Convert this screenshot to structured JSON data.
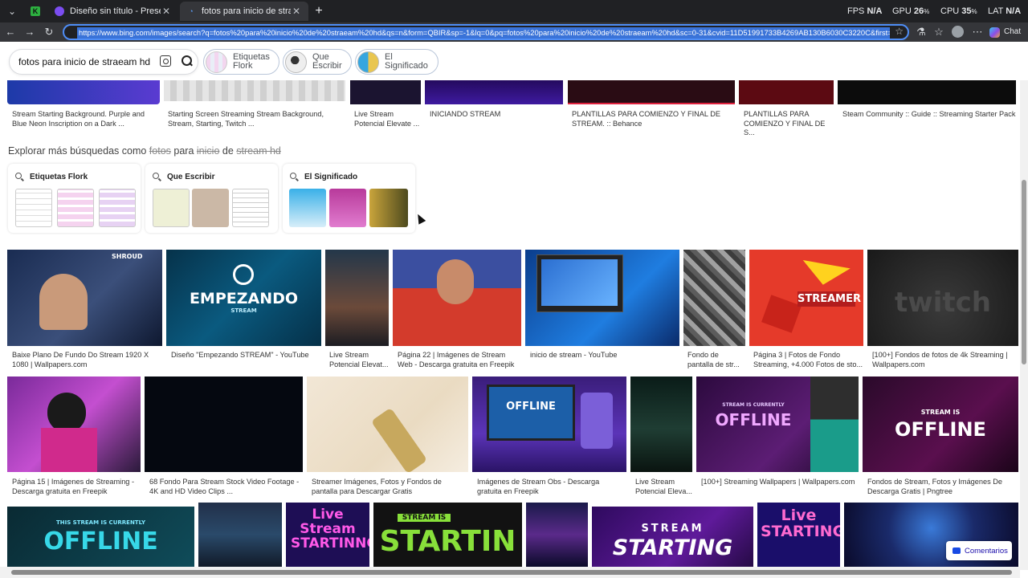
{
  "browser": {
    "tabs": [
      {
        "title": "",
        "favicon": "kahoot-icon",
        "active": false
      },
      {
        "title": "Diseño sin título - Presentación",
        "favicon": "canva-icon",
        "active": false
      },
      {
        "title": "fotos para inicio de straeam hd - B",
        "favicon": "bing-icon",
        "active": true
      }
    ],
    "new_tab": "+",
    "perf": {
      "fps_label": "FPS",
      "fps_value": "N/A",
      "gpu_label": "GPU",
      "gpu_value": "26",
      "cpu_label": "CPU",
      "cpu_value": "35",
      "lat_label": "LAT",
      "lat_value": "N/A",
      "percent": "%"
    },
    "url": "https://www.bing.com/images/search?q=fotos%20para%20inicio%20de%20straeam%20hd&qs=n&form=QBIR&sp=-1&lq=0&pq=fotos%20para%20inicio%20de%20straeam%20hd&sc=0-31&cvid=11D51991733B4269AB130B6030C3220C&first=",
    "chat_label": "Chat"
  },
  "search": {
    "query": "fotos para inicio de straeam hd",
    "chips": [
      {
        "label": "Etiquetas\nFlork"
      },
      {
        "label": "Que\nEscribir"
      },
      {
        "label": "El\nSignificado"
      }
    ]
  },
  "top_row": [
    {
      "caption": "Stream Starting Background. Purple and Blue Neon Inscription on a Dark ..."
    },
    {
      "caption": "Starting Screen Streaming Stream Background, Stream, Starting, Twitch ..."
    },
    {
      "caption": "Live Stream Potencial Elevate ..."
    },
    {
      "caption": "INICIANDO STREAM"
    },
    {
      "caption": "PLANTILLAS PARA COMIENZO Y FINAL DE STREAM. :: Behance"
    },
    {
      "caption": "PLANTILLAS PARA COMIENZO Y FINAL DE S..."
    },
    {
      "caption": "Steam Community :: Guide :: Streaming Starter Pack"
    }
  ],
  "explore": {
    "heading_prefix": "Explorar más búsquedas como",
    "word1": "fotos",
    "word2": "para",
    "word3": "inicio",
    "word4": "de",
    "word5": "stream hd",
    "cards": [
      {
        "label": "Etiquetas Flork"
      },
      {
        "label": "Que Escribir"
      },
      {
        "label": "El Significado"
      }
    ]
  },
  "row1": [
    {
      "caption": "Baixe Plano De Fundo Do Stream 1920 X 1080 | Wallpapers.com",
      "overlay": "SHROUD"
    },
    {
      "caption": "Diseño \"Empezando STREAM\" - YouTube",
      "overlay": "EMPEZANDO",
      "overlay2": "STREAM"
    },
    {
      "caption": "Live Stream Potencial Elevat..."
    },
    {
      "caption": "Página 22 | Imágenes de Stream Web - Descarga gratuita en Freepik"
    },
    {
      "caption": "inicio de stream - YouTube"
    },
    {
      "caption": "Fondo de pantalla de str..."
    },
    {
      "caption": "Página 3 | Fotos de Fondo Streaming, +4.000 Fotos de sto...",
      "overlay": "STREAMER"
    },
    {
      "caption": "[100+] Fondos de fotos de 4k Streaming | Wallpapers.com",
      "overlay": "twitch"
    }
  ],
  "row2": [
    {
      "caption": "Página 15 | Imágenes de Streaming - Descarga gratuita en Freepik"
    },
    {
      "caption": "68 Fondo Para Stream Stock Video Footage - 4K and HD Video Clips ..."
    },
    {
      "caption": "Streamer Imágenes, Fotos y Fondos de pantalla para Descargar Gratis"
    },
    {
      "caption": "Imágenes de Stream Obs - Descarga gratuita en Freepik",
      "overlay": "OFFLINE"
    },
    {
      "caption": "Live Stream Potencial Eleva..."
    },
    {
      "caption": "[100+] Streaming Wallpapers | Wallpapers.com",
      "overlay": "OFFLINE",
      "overlay2": "STREAM IS CURRENTLY"
    },
    {
      "caption": "Fondos de Stream, Fotos y Imágenes De Descarga Gratis | Pngtree",
      "overlay": "OFFLINE",
      "overlay2": "STREAM IS"
    }
  ],
  "row3": [
    {
      "overlay": "OFFLINE",
      "overlay2": "THIS STREAM IS CURRENTLY"
    },
    {
      "overlay": ""
    },
    {
      "overlay": "Live Stream STARTINNG"
    },
    {
      "overlay": "STARTIN",
      "overlay2": "STREAM IS"
    },
    {
      "overlay": ""
    },
    {
      "overlay": "STARTING",
      "overlay2": "STREAM"
    },
    {
      "overlay": "Live STARTING"
    },
    {
      "overlay": ""
    }
  ],
  "feedback_label": "Comentarios"
}
